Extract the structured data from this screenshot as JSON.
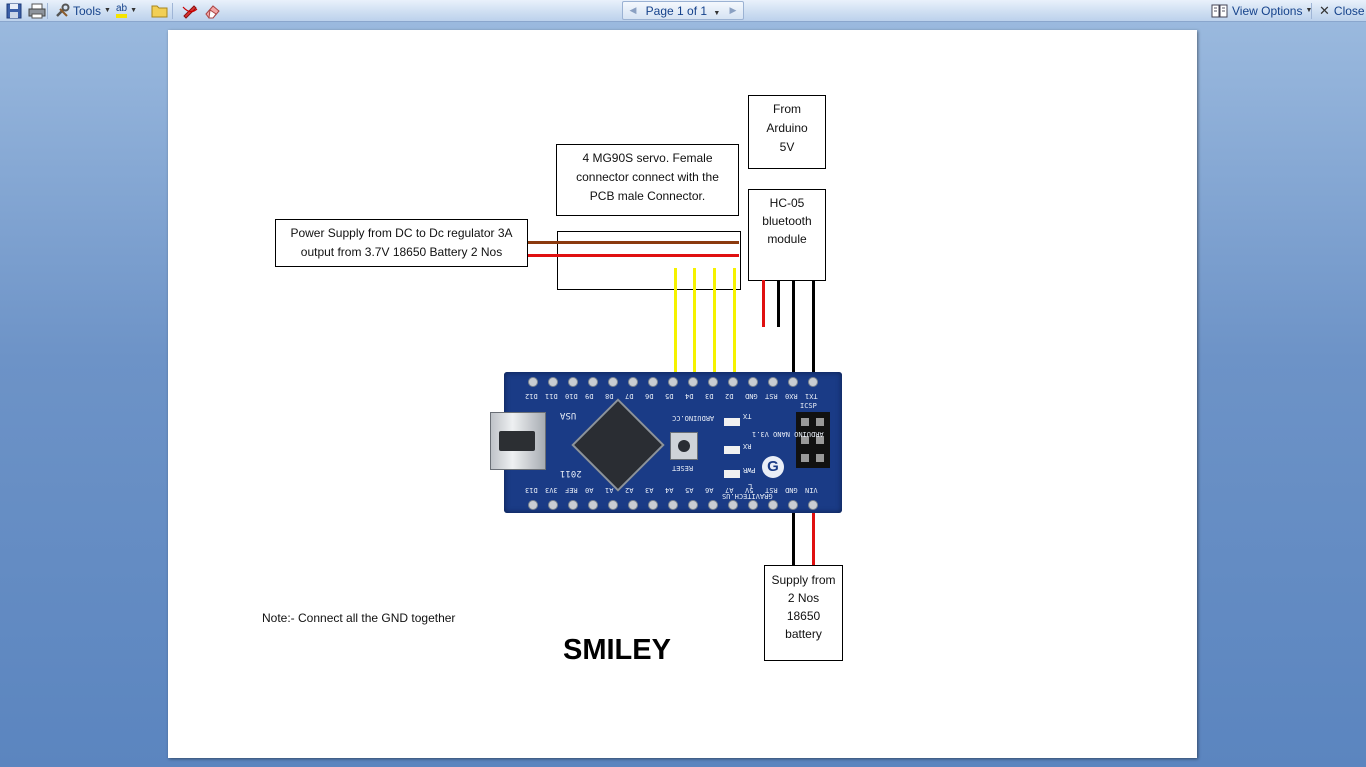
{
  "toolbar": {
    "tools_label": "Tools",
    "page_label": "Page 1 of 1",
    "view_options_label": "View Options",
    "close_label": "Close",
    "spell_icon_text": "ab"
  },
  "document": {
    "servo_box": "4 MG90S servo. Female connector connect with the PCB male Connector.",
    "from_arduino_box": "From Arduino 5V",
    "hc05_box": "HC-05 bluetooth module",
    "power_box": "Power Supply from DC to Dc regulator 3A output from 3.7V 18650 Battery 2 Nos",
    "supply_box": "Supply from 2 Nos 18650 battery",
    "note": "Note:- Connect all the GND together",
    "title": "SMILEY"
  },
  "board": {
    "top_pins": [
      "D12",
      "D11",
      "D10",
      "D9",
      "D8",
      "D7",
      "D6",
      "D5",
      "D4",
      "D3",
      "D2",
      "GND",
      "RST",
      "RX0",
      "TX1"
    ],
    "bottom_pins": [
      "D13",
      "3V3",
      "REF",
      "A0",
      "A1",
      "A2",
      "A3",
      "A4",
      "A5",
      "A6",
      "A7",
      "5V",
      "RST",
      "GND",
      "VIN"
    ],
    "usa": "USA",
    "year": "2011",
    "brand": "ARDUINO.CC",
    "model": "ARDUINO NANO V3.1",
    "maker": "GRAVITECH.US",
    "reset": "RESET",
    "icsp": "ICSP",
    "tx": "TX",
    "rx": "RX",
    "pwr": "PWR",
    "l": "L"
  },
  "colors": {
    "page_bg": "#ffffff",
    "board_blue": "#1a3b86",
    "wire_red": "#e01010",
    "wire_brown": "#8b3a0e",
    "wire_yellow": "#f5f200",
    "wire_black": "#000000"
  }
}
